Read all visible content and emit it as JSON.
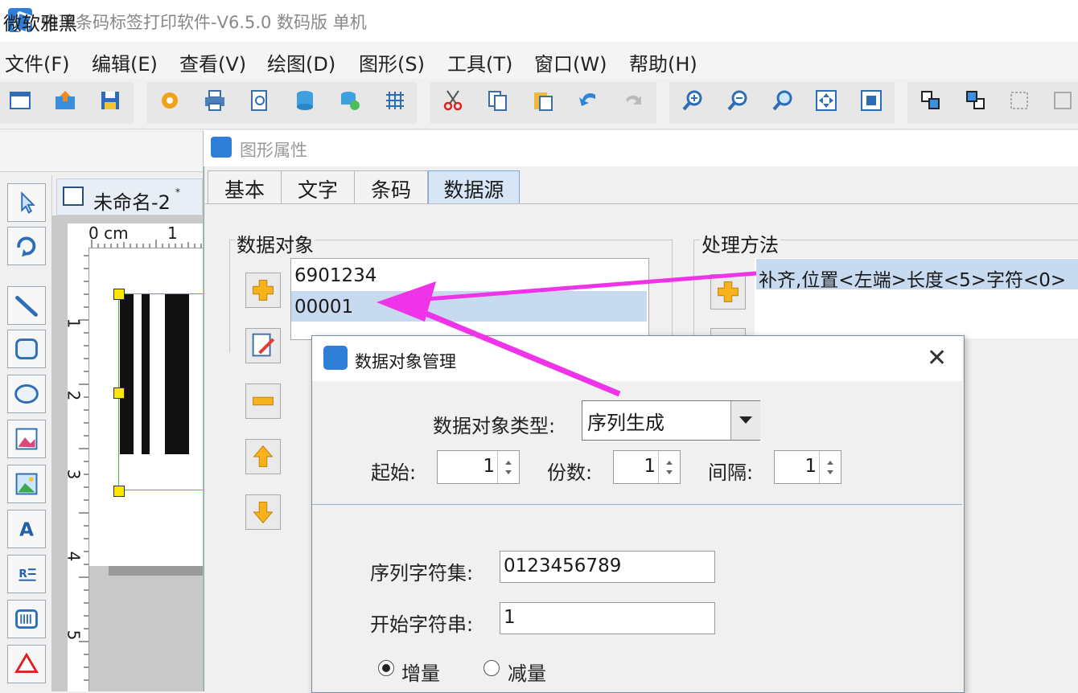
{
  "app": {
    "title": "中琅条码标签打印软件-V6.5.0 数码版 单机"
  },
  "menu": [
    {
      "label": "文件(F)"
    },
    {
      "label": "编辑(E)"
    },
    {
      "label": "查看(V)"
    },
    {
      "label": "绘图(D)"
    },
    {
      "label": "图形(S)"
    },
    {
      "label": "工具(T)"
    },
    {
      "label": "窗口(W)"
    },
    {
      "label": "帮助(H)"
    }
  ],
  "fontbar": {
    "font": "微软雅黑"
  },
  "document": {
    "tab_label": "未命名-2",
    "modified_mark": "*"
  },
  "ruler": {
    "unit": "0 cm",
    "h_marks": [
      "1"
    ],
    "v_marks": [
      "1",
      "2",
      "3",
      "4",
      "5"
    ]
  },
  "prop_window": {
    "title": "图形属性",
    "tabs": [
      "基本",
      "文字",
      "条码",
      "数据源"
    ],
    "active_tab": "数据源",
    "data_objects": {
      "label": "数据对象",
      "items": [
        "6901234",
        "00001"
      ],
      "selected": "00001"
    },
    "methods": {
      "label": "处理方法",
      "items": [
        "补齐,位置<左端>长度<5>字符<0>"
      ]
    }
  },
  "dialog": {
    "title": "数据对象管理",
    "type_label": "数据对象类型:",
    "type_value": "序列生成",
    "start_label": "起始:",
    "start_value": "1",
    "copies_label": "份数:",
    "copies_value": "1",
    "interval_label": "间隔:",
    "interval_value": "1",
    "charset_label": "序列字符集:",
    "charset_value": "0123456789",
    "start_string_label": "开始字符串:",
    "start_string_value": "1",
    "increment_label": "增量",
    "decrement_label": "减量",
    "direction": "增量"
  },
  "colors": {
    "accent": "#2f7fd8",
    "selection": "#c7daf0",
    "annotation_arrow": "#ee33e8"
  }
}
